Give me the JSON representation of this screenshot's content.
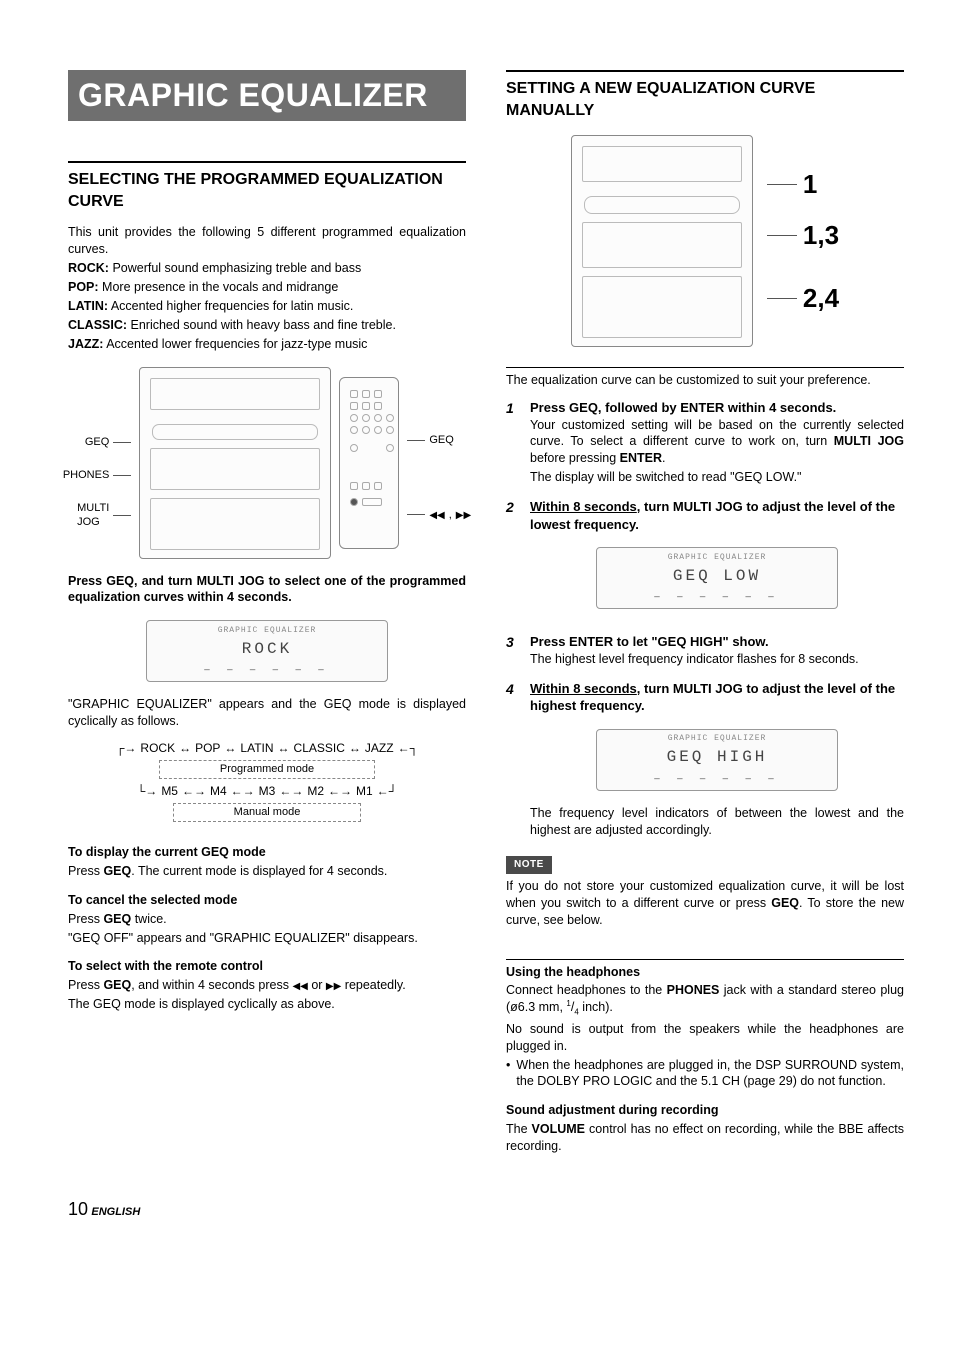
{
  "banner": "GRAPHIC EQUALIZER",
  "left": {
    "heading": "SELECTING THE PROGRAMMED EQUALIZATION CURVE",
    "intro": "This unit provides the following 5 different programmed equalization curves.",
    "modes": {
      "rock_label": "ROCK:",
      "rock_desc": " Powerful sound emphasizing treble and bass",
      "pop_label": "POP:",
      "pop_desc": " More presence in the vocals and midrange",
      "latin_label": "LATIN:",
      "latin_desc": " Accented higher frequencies for latin music.",
      "classic_label": "CLASSIC:",
      "classic_desc": " Enriched sound with heavy bass and fine treble.",
      "jazz_label": "JAZZ:",
      "jazz_desc": " Accented lower frequencies for jazz-type music"
    },
    "fig1_labels": {
      "geq": "GEQ",
      "phones": "PHONES",
      "multijog": "MULTI\nJOG",
      "geq_r": "GEQ",
      "seek": ","
    },
    "instruction": "Press GEQ, and turn MULTI JOG to select one of the programmed equalization curves within 4 seconds.",
    "display1_sub": "GRAPHIC EQUALIZER",
    "display1_text": "ROCK",
    "cyclic_text": "\"GRAPHIC EQUALIZER\" appears and the GEQ mode is displayed cyclically as follows.",
    "cycle": {
      "prog": [
        "ROCK",
        "POP",
        "LATIN",
        "CLASSIC",
        "JAZZ"
      ],
      "prog_label": "Programmed mode",
      "manual": [
        "M5",
        "M4",
        "M3",
        "M2",
        "M1"
      ],
      "manual_label": "Manual mode"
    },
    "sub1_h": "To display the current GEQ mode",
    "sub1_p_a": "Press ",
    "sub1_p_b": "GEQ",
    "sub1_p_c": ". The current mode is displayed for 4 seconds.",
    "sub2_h": "To cancel the selected mode",
    "sub2_p1_a": "Press ",
    "sub2_p1_b": "GEQ",
    "sub2_p1_c": " twice.",
    "sub2_p2": "\"GEQ OFF\" appears and \"GRAPHIC EQUALIZER\" disappears.",
    "sub3_h": "To select with the remote control",
    "sub3_p1_a": "Press ",
    "sub3_p1_b": "GEQ",
    "sub3_p1_c": ", and within 4 seconds press ",
    "sub3_p1_d": " or ",
    "sub3_p1_e": "  repeatedly.",
    "sub3_p2": "The GEQ mode is displayed cyclically as above."
  },
  "right": {
    "heading": "SETTING  A NEW EQUALIZATION CURVE MANUALLY",
    "callouts": {
      "a": "1",
      "b": "1,3",
      "c": "2,4"
    },
    "intro": "The equalization curve can be customized to suit your preference.",
    "steps": {
      "s1_lead": "Press GEQ, followed by ENTER within 4 seconds.",
      "s1_p1_a": "Your customized setting will be based on the currently selected curve. To select a different curve to work on, turn ",
      "s1_p1_b": "MULTI JOG",
      "s1_p1_c": " before pressing ",
      "s1_p1_d": "ENTER",
      "s1_p1_e": ".",
      "s1_p2": "The display will be switched to read \"GEQ LOW.\"",
      "s2_lead_a": "Within 8 seconds",
      "s2_lead_b": ", turn MULTI JOG to adjust the level of the lowest frequency.",
      "disp2_sub": "GRAPHIC EQUALIZER",
      "disp2_text": "GEQ  LOW",
      "s3_lead": "Press ENTER to let \"GEQ HIGH\" show.",
      "s3_p1": "The highest level frequency indicator flashes for 8 seconds.",
      "s4_lead_a": "Within 8 seconds",
      "s4_lead_b": ", turn MULTI JOG to adjust the level of the highest frequency.",
      "disp3_sub": "GRAPHIC EQUALIZER",
      "disp3_text": "GEQ HIGH",
      "tail": "The frequency level indicators of between the lowest and the highest are adjusted accordingly."
    },
    "note_badge": "NOTE",
    "note_a": "If you do not store your customized equalization curve, it will be lost when you switch to a different curve or press ",
    "note_b": "GEQ",
    "note_c": ". To store the new curve, see below.",
    "hp_h": "Using the headphones",
    "hp_p1_a": "Connect headphones to the ",
    "hp_p1_b": "PHONES",
    "hp_p1_c": " jack with a standard stereo plug (ø6.3 mm, ",
    "hp_frac_n": "1",
    "hp_frac_d": "4",
    "hp_p1_d": " inch).",
    "hp_p2": "No sound is output from the speakers while the headphones are plugged in.",
    "hp_b1": "When the headphones are plugged in, the DSP SURROUND system, the DOLBY PRO LOGIC and the 5.1 CH (page 29) do not function.",
    "rec_h": "Sound adjustment during recording",
    "rec_a": "The ",
    "rec_b": "VOLUME",
    "rec_c": " control has no effect on recording, while the BBE affects recording."
  },
  "footer": {
    "page": "10",
    "lang": "ENGLISH"
  }
}
